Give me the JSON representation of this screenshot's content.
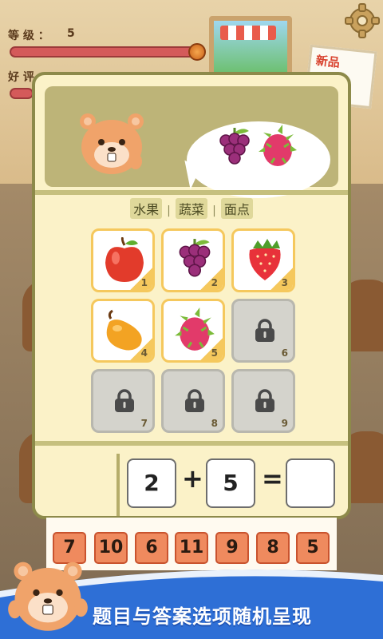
{
  "hud": {
    "level_label": "等 级 ：",
    "level_value": "5",
    "rating_label": "好 评"
  },
  "poster_text": "新品",
  "tabs": [
    "水果",
    "蔬菜",
    "面点"
  ],
  "tab_separator": "|",
  "request": {
    "items": [
      "grape-icon",
      "dragonfruit-icon"
    ]
  },
  "items": [
    {
      "num": "1",
      "icon": "apple-icon",
      "locked": false
    },
    {
      "num": "2",
      "icon": "grape-icon",
      "locked": false
    },
    {
      "num": "3",
      "icon": "strawberry-icon",
      "locked": false
    },
    {
      "num": "4",
      "icon": "mango-icon",
      "locked": false
    },
    {
      "num": "5",
      "icon": "dragonfruit-icon",
      "locked": false
    },
    {
      "num": "6",
      "icon": "lock-icon",
      "locked": true
    },
    {
      "num": "7",
      "icon": "lock-icon",
      "locked": true
    },
    {
      "num": "8",
      "icon": "lock-icon",
      "locked": true
    },
    {
      "num": "9",
      "icon": "lock-icon",
      "locked": true
    }
  ],
  "equation": {
    "a": "2",
    "op": "+",
    "b": "5",
    "eq": "=",
    "answer": ""
  },
  "answers": [
    "7",
    "10",
    "6",
    "11",
    "9",
    "8",
    "5"
  ],
  "banner_text": "题目与答案选项随机呈现",
  "colors": {
    "panel_border": "#8d8a4a",
    "answer_fill": "#ef8a5e",
    "banner_blue": "#2e6fd6"
  }
}
